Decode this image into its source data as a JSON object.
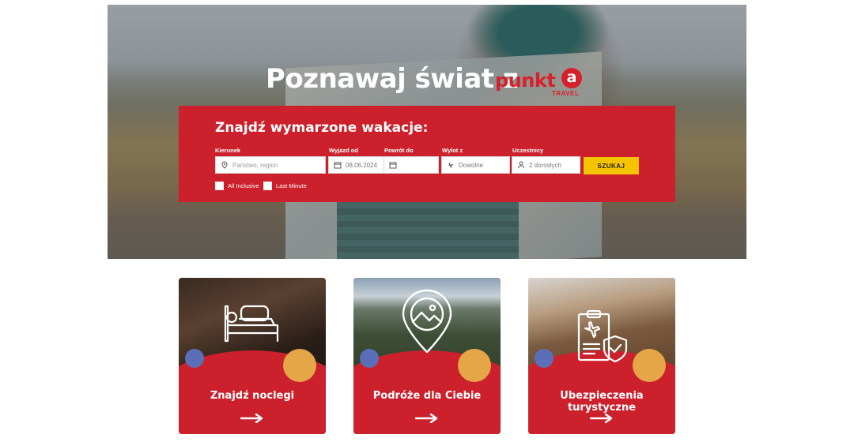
{
  "hero": {
    "title": "Poznawaj świat z",
    "logo_word": "punkt",
    "logo_letter": "a",
    "logo_sub": "TRAVEL"
  },
  "search": {
    "title": "Znajdź wymarzone wakacje:",
    "destination": {
      "label": "Kierunek",
      "placeholder": "Państwo, region",
      "icon": "pin-icon"
    },
    "departure": {
      "label": "Wyjazd od",
      "value": "08.06.2024",
      "icon": "calendar-icon"
    },
    "return": {
      "label": "Powrót do",
      "value": "",
      "icon": "calendar-icon"
    },
    "flight_from": {
      "label": "Wylot z",
      "value": "Dowolne",
      "icon": "plane-icon"
    },
    "participants": {
      "label": "Uczestnicy",
      "value": "2 dorosłych",
      "icon": "user-icon"
    },
    "button": "SZUKAJ",
    "checkboxes": [
      {
        "label": "All Inclusive",
        "checked": false
      },
      {
        "label": "Last Minute",
        "checked": false
      }
    ]
  },
  "cards": [
    {
      "title": "Znajdź noclegi",
      "icon": "bed-icon"
    },
    {
      "title": "Podróże dla Ciebie",
      "icon": "map-pin-landscape-icon"
    },
    {
      "title": "Ubezpieczenia turystyczne",
      "icon": "insurance-shield-icon"
    }
  ],
  "colors": {
    "brand_red": "#cc212d",
    "accent_yellow": "#f5c400",
    "dot_blue": "#5b6fb8",
    "dot_orange": "#e5a647"
  }
}
